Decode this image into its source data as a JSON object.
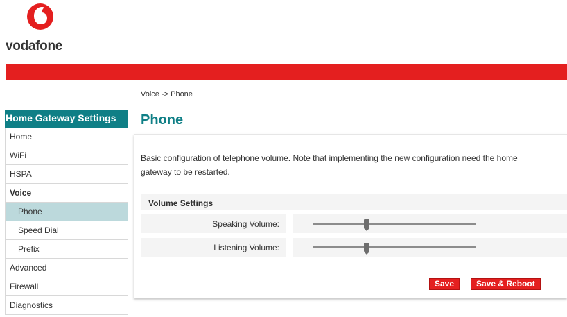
{
  "brand": {
    "name": "vodafone",
    "color": "#e41f1f",
    "icon": "vodafone-speechmark-logo"
  },
  "breadcrumb": "Voice -> Phone",
  "sidebar": {
    "title": "Home Gateway Settings",
    "items": [
      {
        "label": "Home"
      },
      {
        "label": "WiFi"
      },
      {
        "label": "HSPA"
      },
      {
        "label": "Voice"
      },
      {
        "label": "Phone"
      },
      {
        "label": "Speed Dial"
      },
      {
        "label": "Prefix"
      },
      {
        "label": "Advanced"
      },
      {
        "label": "Firewall"
      },
      {
        "label": "Diagnostics"
      }
    ],
    "active_item": "Phone",
    "accent_color": "#0f7f86"
  },
  "main": {
    "title": "Phone",
    "description": "Basic configuration of telephone volume. Note that implementing the new configuration need the home gateway to be restarted.",
    "volume_settings": {
      "heading": "Volume Settings",
      "speaking_label": "Speaking Volume:",
      "speaking_level": 0.33,
      "listening_label": "Listening Volume:",
      "listening_level": 0.33
    },
    "buttons": {
      "save": "Save",
      "save_reboot": "Save & Reboot"
    }
  }
}
